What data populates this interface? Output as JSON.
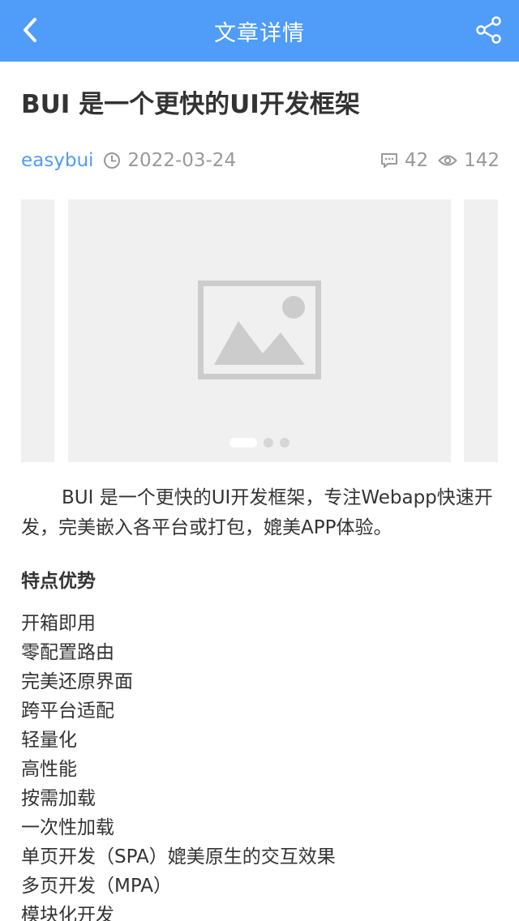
{
  "header": {
    "title": "文章详情",
    "back_icon": "chevron-left-icon",
    "share_icon": "share-icon",
    "bg_color": "#4f9cf9"
  },
  "article": {
    "title": "BUI 是一个更快的UI开发框架",
    "author": "easybui",
    "date": "2022-03-24",
    "comment_count": "42",
    "view_count": "142",
    "intro": "BUI 是一个更快的UI开发框架，专注Webapp快速开发，完美嵌入各平台或打包，媲美APP体验。",
    "section_title": "特点优势",
    "features": [
      "开箱即用",
      "零配置路由",
      "完美还原界面",
      "跨平台适配",
      "轻量化",
      "高性能",
      "按需加载",
      "一次性加载",
      "单页开发（SPA）媲美原生的交互效果",
      "多页开发（MPA）",
      "模块化开发"
    ]
  },
  "slider": {
    "slide_count": 3,
    "active_index": 0,
    "placeholder_icon": "image-placeholder-icon"
  },
  "colors": {
    "accent": "#4f9cf9",
    "text": "#333333",
    "muted": "#999999"
  }
}
